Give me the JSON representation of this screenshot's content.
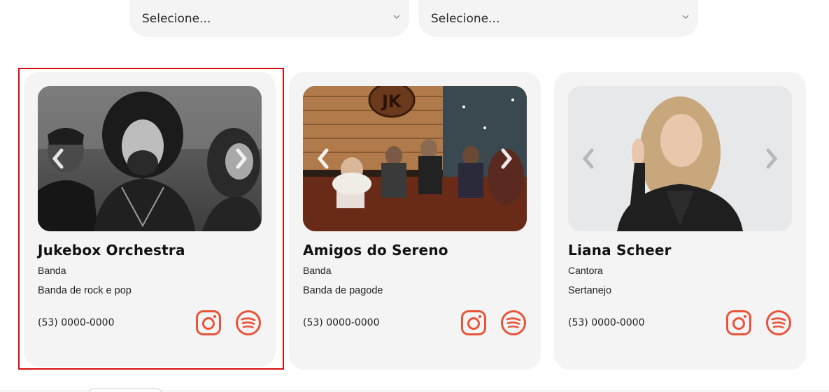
{
  "filters": [
    {
      "value": "Selecione..."
    },
    {
      "value": "Selecione..."
    }
  ],
  "colors": {
    "accent": "#e8543a",
    "card_bg": "#f4f4f4",
    "selection": "#d60d0d"
  },
  "artists": [
    {
      "name": "Jukebox Orchestra",
      "category": "Banda",
      "description": "Banda de rock e pop",
      "phone": "(53) 0000-0000"
    },
    {
      "name": "Amigos do Sereno",
      "category": "Banda",
      "description": "Banda de pagode",
      "phone": "(53) 0000-0000"
    },
    {
      "name": "Liana Scheer",
      "category": "Cantora",
      "description": "Sertanejo",
      "phone": "(53) 0000-0000"
    }
  ],
  "icons": {
    "instagram": "instagram-icon",
    "spotify": "spotify-icon",
    "prev": "chevron-left-icon",
    "next": "chevron-right-icon",
    "dropdown": "chevron-down-icon"
  }
}
